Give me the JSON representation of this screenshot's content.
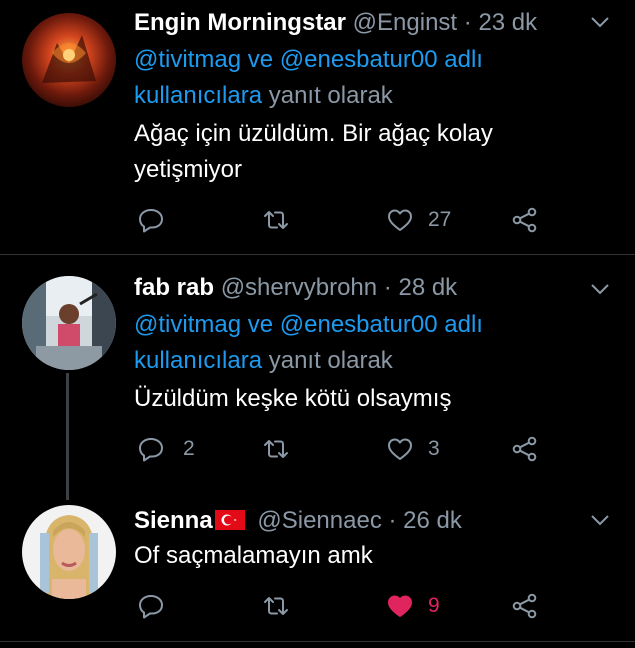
{
  "tweets": [
    {
      "name": "Engin Morningstar",
      "handle": "@Enginst",
      "time": "23 dk",
      "mention1": "@tivitmag",
      "mention_joiner": "ve",
      "mention2": "@enesbatur00",
      "mention_suffix": "adlı",
      "reply_link": "kullanıcılara",
      "reply_label": "yanıt olarak",
      "text_line1": "Ağaç için üzüldüm. Bir ağaç kolay",
      "text_line2": "yetişmiyor",
      "replies": "",
      "likes": "27",
      "liked": false
    },
    {
      "name": "fab rab",
      "handle": "@shervybrohn",
      "time": "28 dk",
      "mention1": "@tivitmag",
      "mention_joiner": "ve",
      "mention2": "@enesbatur00",
      "mention_suffix": "adlı",
      "reply_link": "kullanıcılara",
      "reply_label": "yanıt olarak",
      "text_line1": "Üzüldüm keşke kötü olsaymış",
      "replies": "2",
      "likes": "3",
      "liked": false
    },
    {
      "name": "Sienna",
      "flag": "turkey-flag",
      "handle": "@Siennaec",
      "time": "26 dk",
      "text_line1": "Of saçmalamayın amk",
      "replies": "",
      "likes": "9",
      "liked": true
    }
  ],
  "separator": "·",
  "icons": {
    "reply": "reply-icon",
    "retweet": "retweet-icon",
    "like": "heart-icon",
    "share": "share-icon",
    "more": "chevron-down-icon"
  },
  "colors": {
    "background": "#000000",
    "link": "#1d9bf0",
    "muted": "#8b98a5",
    "liked": "#e0245e",
    "divider": "#2f3336"
  }
}
